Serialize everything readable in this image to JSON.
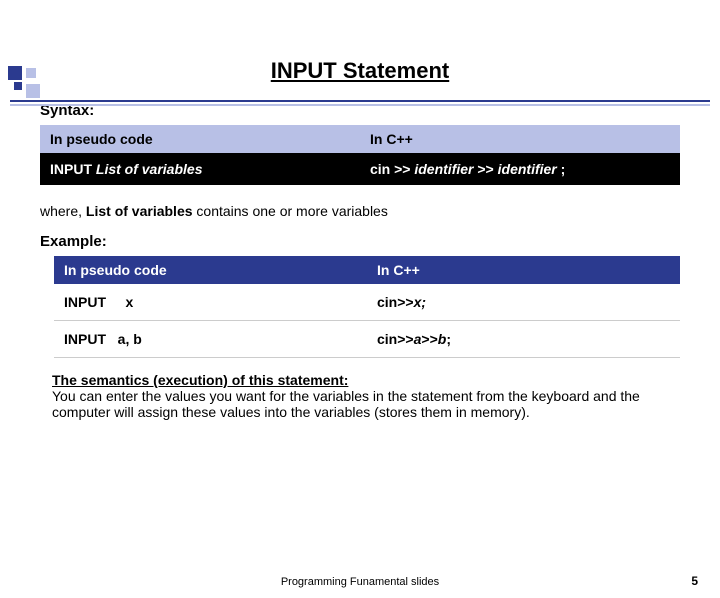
{
  "title": "INPUT Statement",
  "syntax_label": "Syntax:",
  "table1": {
    "head_left": "In pseudo code",
    "head_right": "In C++",
    "row_left_1": "INPUT  ",
    "row_left_2": "List of variables",
    "row_right_1": "cin  >>  ",
    "row_right_2": "identifier",
    "row_right_3": " >> ",
    "row_right_4": "identifier",
    "row_right_5": " ;"
  },
  "where_1": "where, ",
  "where_2": "List of variables ",
  "where_3": "contains one or more variables",
  "example_label": "Example:",
  "table2": {
    "head_left": "In pseudo code",
    "head_right": "In C++",
    "r1_left": "INPUT     x",
    "r1_right_a": "cin>>",
    "r1_right_b": "x;",
    "r2_left": "INPUT   a, b",
    "r2_right_a": "cin>>",
    "r2_right_b": "a",
    "r2_right_c": ">>",
    "r2_right_d": "b",
    "r2_right_e": ";"
  },
  "semantics_h": "The semantics (execution) of this statement:",
  "semantics_body": "You can enter the values you want for the variables in the statement from the keyboard and the computer will assign these values into the variables (stores them in memory).",
  "footer": "Programming Funamental slides",
  "page": "5"
}
